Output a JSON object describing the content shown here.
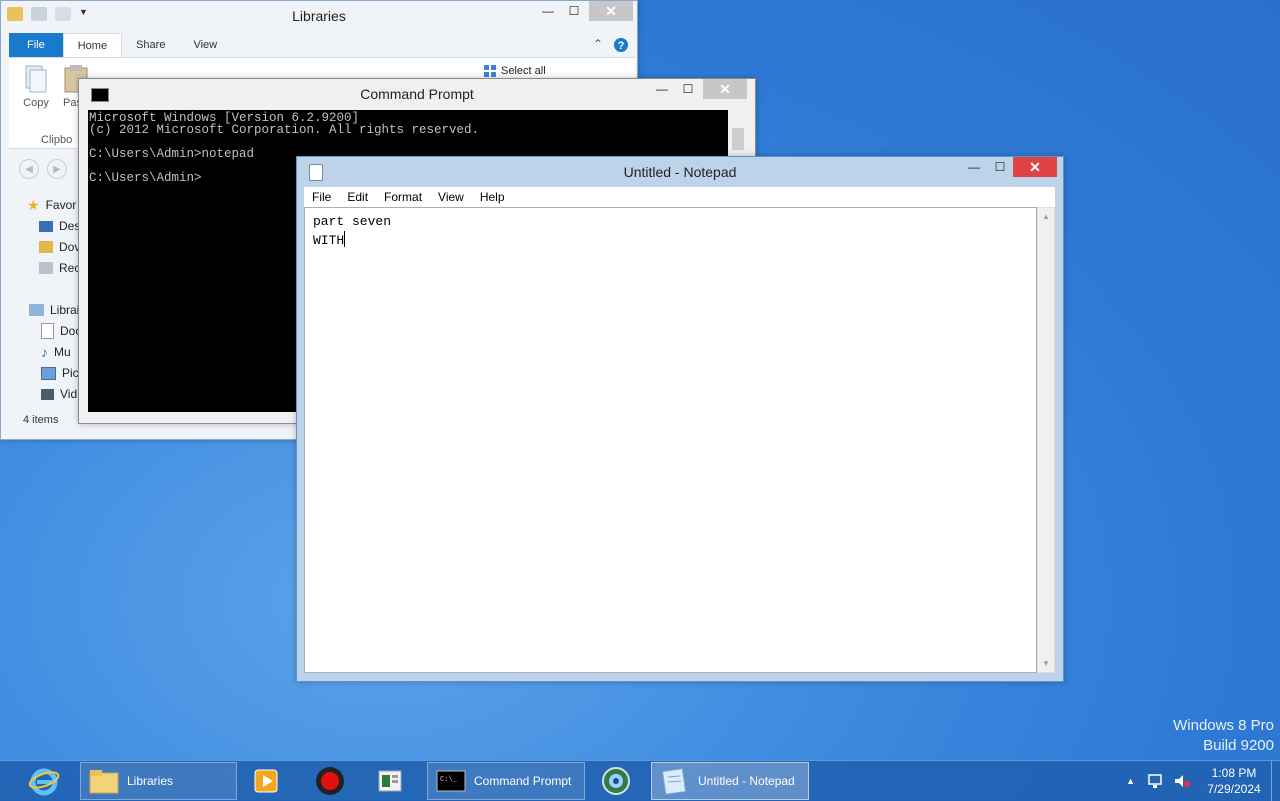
{
  "desktop": {
    "watermark_line1": "Windows 8 Pro",
    "watermark_line2": "Build 9200"
  },
  "explorer": {
    "title": "Libraries",
    "tabs": {
      "file": "File",
      "home": "Home",
      "share": "Share",
      "view": "View"
    },
    "ribbon": {
      "copy": "Copy",
      "paste": "Pas",
      "select_all": "Select all",
      "clipboard_group": "Clipbo"
    },
    "nav": {
      "favorites": "Favor",
      "desktop": "Des",
      "downloads": "Dov",
      "recent": "Rec",
      "libraries": "Librai",
      "documents": "Doc",
      "music": "Mu",
      "pictures": "Pict",
      "videos": "Vid"
    },
    "status": "4 items"
  },
  "cmd": {
    "title": "Command Prompt",
    "lines": [
      "Microsoft Windows [Version 6.2.9200]",
      "(c) 2012 Microsoft Corporation. All rights reserved.",
      "",
      "C:\\Users\\Admin>notepad",
      "",
      "C:\\Users\\Admin>"
    ]
  },
  "notepad": {
    "title": "Untitled - Notepad",
    "menu": {
      "file": "File",
      "edit": "Edit",
      "format": "Format",
      "view": "View",
      "help": "Help"
    },
    "line1": "part seven",
    "line2": "WITH"
  },
  "taskbar": {
    "libraries": "Libraries",
    "command_prompt": "Command Prompt",
    "notepad": "Untitled - Notepad",
    "time": "1:08 PM",
    "date": "7/29/2024"
  },
  "colors": {
    "accent": "#1979ca",
    "close_active": "#e04343",
    "desktop": "#3f8ce0"
  },
  "icons": [
    "ie-icon",
    "folder-icon",
    "media-player-icon",
    "record-icon",
    "app-icon",
    "cmd-icon",
    "network-globe-icon",
    "notepad-icon",
    "tray-arrow-icon",
    "network-icon",
    "volume-muted-icon"
  ]
}
